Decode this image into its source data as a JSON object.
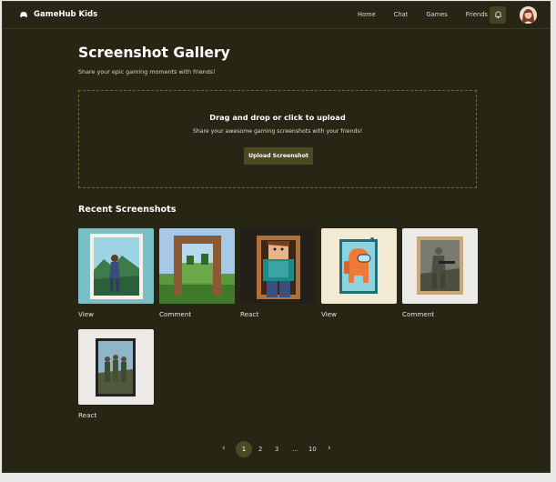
{
  "nav": {
    "brand": "GameHub Kids",
    "links": [
      "Home",
      "Chat",
      "Games",
      "Friends"
    ]
  },
  "page": {
    "title": "Screenshot Gallery",
    "subtitle": "Share your epic gaming moments with friends!"
  },
  "upload": {
    "title": "Drag and drop or click to upload",
    "subtitle": "Share your awesome gaming screenshots with your friends!",
    "button": "Upload Screenshot"
  },
  "recent": {
    "heading": "Recent Screenshots",
    "items": [
      {
        "label": "View"
      },
      {
        "label": "Comment"
      },
      {
        "label": "React"
      },
      {
        "label": "View"
      },
      {
        "label": "Comment"
      },
      {
        "label": "React"
      }
    ]
  },
  "pagination": {
    "prev": "‹",
    "pages": [
      "1",
      "2",
      "3",
      "...",
      "10"
    ],
    "next": "›",
    "current": "1"
  },
  "colors": {
    "background": "#272514",
    "accent": "#4d4a23",
    "dashed_border": "#6f6a33"
  },
  "icons": [
    "gamepad-icon",
    "bell-icon",
    "chevron-left-icon",
    "chevron-right-icon"
  ]
}
